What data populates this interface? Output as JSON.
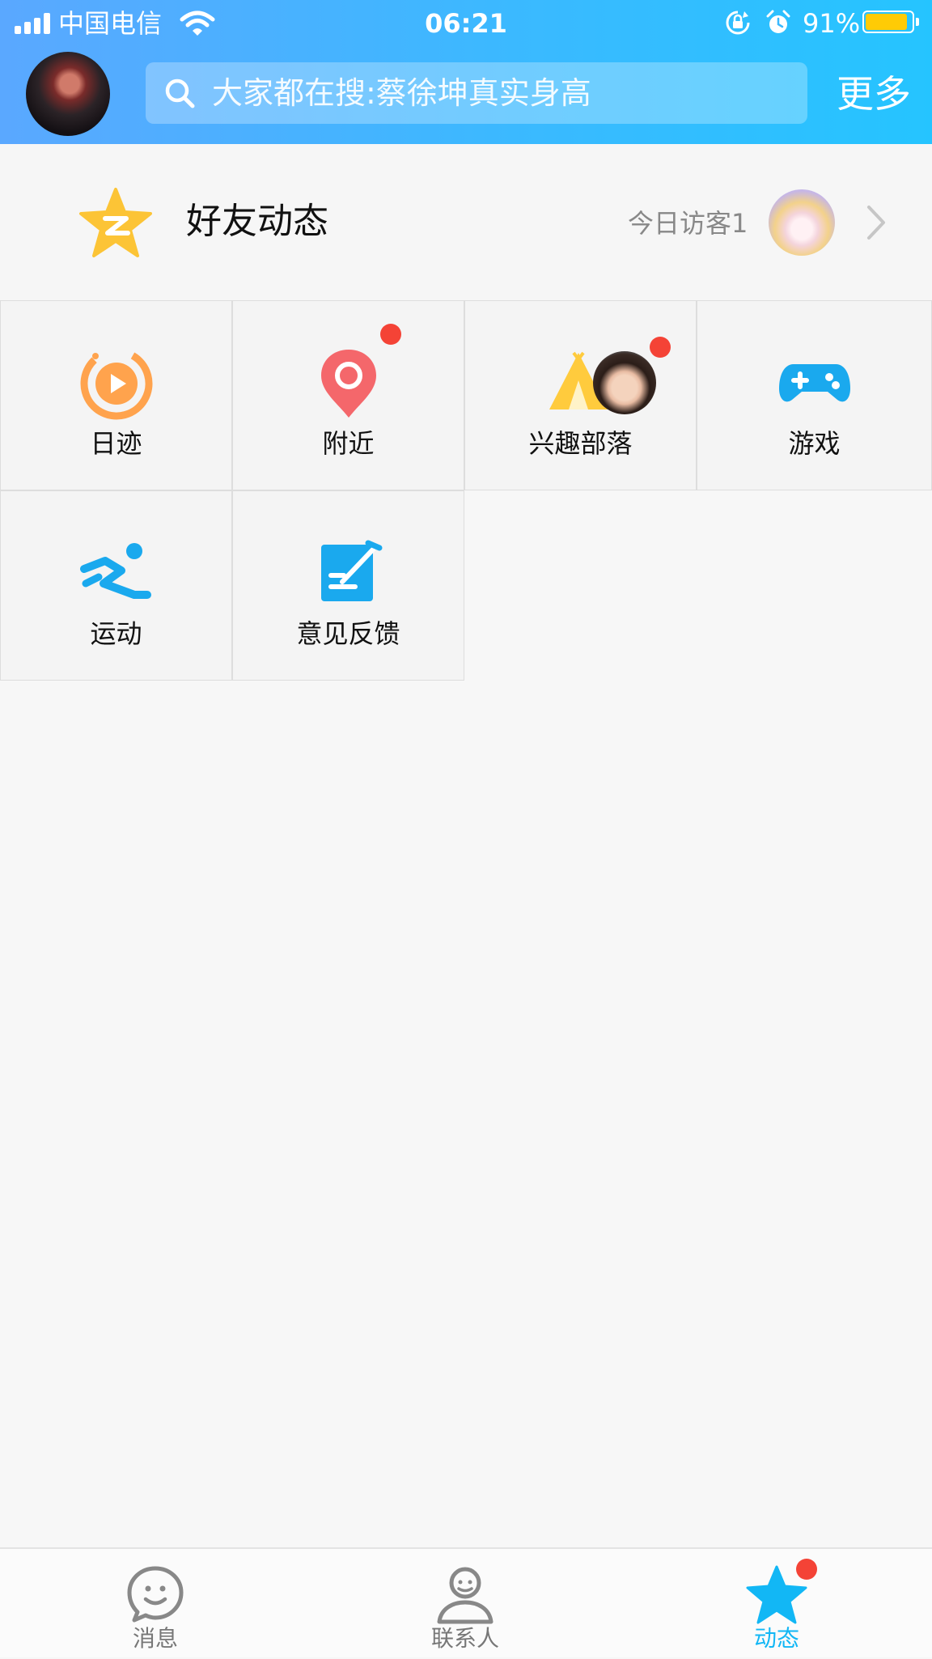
{
  "status_bar": {
    "carrier": "中国电信",
    "time": "06:21",
    "battery_percent": "91%",
    "battery_level": 0.91,
    "icons": [
      "signal-icon",
      "wifi-icon",
      "rotation-lock-icon",
      "alarm-icon",
      "battery-icon"
    ]
  },
  "header": {
    "avatar": "user-avatar",
    "search_placeholder": "大家都在搜:蔡徐坤真实身高",
    "more_label": "更多"
  },
  "feed": {
    "title": "好友动态",
    "visitors_label": "今日访客1",
    "icon": "qzone-star-icon"
  },
  "grid": {
    "items": [
      {
        "label": "日迹",
        "icon": "play-icon",
        "badge": false
      },
      {
        "label": "附近",
        "icon": "location-pin-icon",
        "badge": true
      },
      {
        "label": "兴趣部落",
        "icon": "tent-icon",
        "badge": true
      },
      {
        "label": "游戏",
        "icon": "gamepad-icon",
        "badge": false
      },
      {
        "label": "运动",
        "icon": "running-icon",
        "badge": false
      },
      {
        "label": "意见反馈",
        "icon": "feedback-edit-icon",
        "badge": false
      }
    ]
  },
  "tabbar": {
    "tabs": [
      {
        "label": "消息",
        "icon": "message-smile-icon",
        "active": false
      },
      {
        "label": "联系人",
        "icon": "contact-person-icon",
        "active": false
      },
      {
        "label": "动态",
        "icon": "star-icon",
        "active": true,
        "badge": true
      }
    ]
  },
  "colors": {
    "header_gradient_start": "#5aa8ff",
    "header_gradient_end": "#25c4ff",
    "active_tab": "#12b7f5",
    "badge_red": "#f44336",
    "battery_fill": "#ffcb05"
  }
}
